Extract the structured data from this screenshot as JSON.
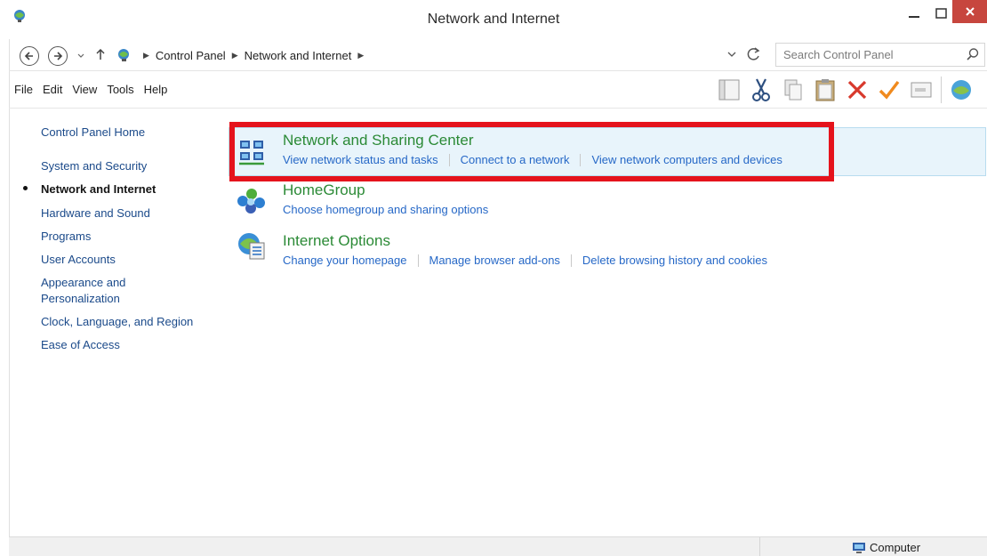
{
  "window": {
    "title": "Network and Internet",
    "close_color": "#c7463e"
  },
  "address": {
    "crumbs": [
      "Control Panel",
      "Network and Internet"
    ],
    "search_placeholder": "Search Control Panel"
  },
  "menu": [
    "File",
    "Edit",
    "View",
    "Tools",
    "Help"
  ],
  "toolbar_icons": [
    "layout-icon",
    "cut-icon",
    "copy-icon",
    "paste-icon",
    "delete-icon",
    "properties-icon",
    "rename-icon",
    "network-globe-icon"
  ],
  "leftnav": {
    "home": "Control Panel Home",
    "categories": [
      {
        "label": "System and Security",
        "active": false
      },
      {
        "label": "Network and Internet",
        "active": true
      },
      {
        "label": "Hardware and Sound",
        "active": false
      },
      {
        "label": "Programs",
        "active": false
      },
      {
        "label": "User Accounts",
        "active": false
      },
      {
        "label": "Appearance and Personalization",
        "active": false
      },
      {
        "label": "Clock, Language, and Region",
        "active": false
      },
      {
        "label": "Ease of Access",
        "active": false
      }
    ]
  },
  "sections": [
    {
      "heading": "Network and Sharing Center",
      "links": [
        "View network status and tasks",
        "Connect to a network",
        "View network computers and devices"
      ]
    },
    {
      "heading": "HomeGroup",
      "links": [
        "Choose homegroup and sharing options"
      ]
    },
    {
      "heading": "Internet Options",
      "links": [
        "Change your homepage",
        "Manage browser add-ons",
        "Delete browsing history and cookies"
      ]
    }
  ],
  "status": {
    "computer_label": "Computer"
  },
  "colors": {
    "heading_green": "#2b8a36",
    "link_blue": "#2668c7",
    "highlight_red": "#e5131c",
    "hover_bg": "#e8f4fb"
  }
}
